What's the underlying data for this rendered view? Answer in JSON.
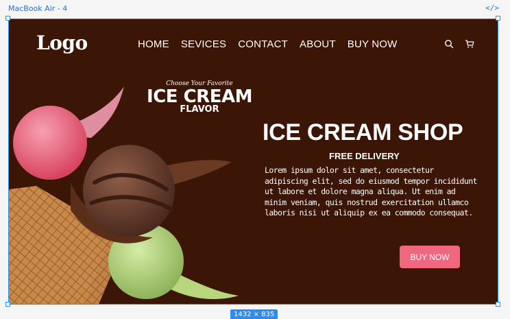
{
  "canvas": {
    "frame_name": "MacBook Air - 4",
    "size_label": "1432 × 835",
    "code_icon": "</>"
  },
  "header": {
    "logo": "Logo",
    "nav": [
      "HOME",
      "SEVICES",
      "CONTACT",
      "ABOUT",
      "BUY NOW"
    ],
    "icons": [
      "search-icon",
      "cart-icon"
    ]
  },
  "badge": {
    "tagline": "Choose Your Favorite",
    "title": "ICE CREAM",
    "subtitle": "FLAVOR"
  },
  "hero": {
    "title": "ICE CREAM SHOP",
    "subtitle": "FREE DELIVERY",
    "body": "Lorem ipsum dolor sit amet, consectetur adipiscing elit, sed do eiusmod tempor incididunt ut labore et dolore magna aliqua. Ut enim ad minim veniam, quis nostrud exercitation ullamco laboris nisi ut aliquip ex ea commodo consequat.",
    "cta": "BUY NOW"
  },
  "colors": {
    "background": "#3b1606",
    "accent": "#f0677f",
    "selection": "#2d8cf0"
  }
}
